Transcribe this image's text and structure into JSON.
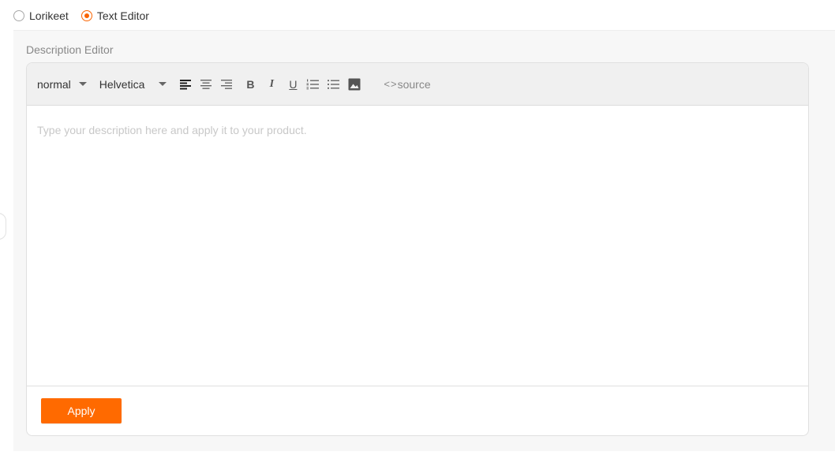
{
  "mode": {
    "options": [
      {
        "label": "Lorikeet",
        "selected": false
      },
      {
        "label": "Text Editor",
        "selected": true
      }
    ]
  },
  "panel": {
    "title": "Description Editor"
  },
  "toolbar": {
    "header_select": "normal",
    "font_select": "Helvetica",
    "align_left_icon": "align-left-icon",
    "align_center_icon": "align-center-icon",
    "align_right_icon": "align-right-icon",
    "bold_label": "B",
    "italic_label": "I",
    "underline_label": "U",
    "ordered_list_icon": "ordered-list-icon",
    "bullet_list_icon": "bullet-list-icon",
    "image_icon": "image-icon",
    "source_label": "source"
  },
  "editor": {
    "placeholder": "Type your description here and apply it to your product."
  },
  "footer": {
    "apply_label": "Apply"
  },
  "colors": {
    "accent": "#fa6400",
    "apply_button": "#ff6a00",
    "panel_bg": "#f7f7f7",
    "toolbar_bg": "#f0f0f0"
  }
}
